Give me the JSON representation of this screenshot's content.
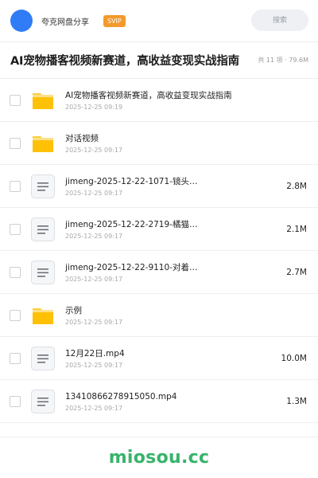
{
  "header": {
    "brand": "夸克网盘分享",
    "badge": "SVIP",
    "search_placeholder": "搜索"
  },
  "title": {
    "text": "AI宠物播客视频新赛道，高收益变现实战指南",
    "meta": "共 11 项 · 79.6M"
  },
  "items": [
    {
      "type": "folder",
      "name": "AI宠物播客视频新赛道，高收益变现实战指南",
      "date": "2025-12-25 09:19",
      "size": ""
    },
    {
      "type": "folder",
      "name": "对话视频",
      "date": "2025-12-25 09:17",
      "size": ""
    },
    {
      "type": "file",
      "name": "jimeng-2025-12-22-1071-镜头…",
      "date": "2025-12-25 09:17",
      "size": "2.8M"
    },
    {
      "type": "file",
      "name": "jimeng-2025-12-22-2719-橘猫…",
      "date": "2025-12-25 09:17",
      "size": "2.1M"
    },
    {
      "type": "file",
      "name": "jimeng-2025-12-22-9110-对着…",
      "date": "2025-12-25 09:17",
      "size": "2.7M"
    },
    {
      "type": "folder",
      "name": "示例",
      "date": "2025-12-25 09:17",
      "size": ""
    },
    {
      "type": "file",
      "name": "12月22日.mp4",
      "date": "2025-12-25 09:17",
      "size": "10.0M"
    },
    {
      "type": "file",
      "name": "13410866278915050.mp4",
      "date": "2025-12-25 09:17",
      "size": "1.3M"
    }
  ],
  "footer": {
    "watermark": "miosou.cc"
  },
  "colors": {
    "avatar": "#2f7cf6",
    "badge": "#f39a2c",
    "folder": "#ffc107",
    "watermark": "#38b36b"
  }
}
